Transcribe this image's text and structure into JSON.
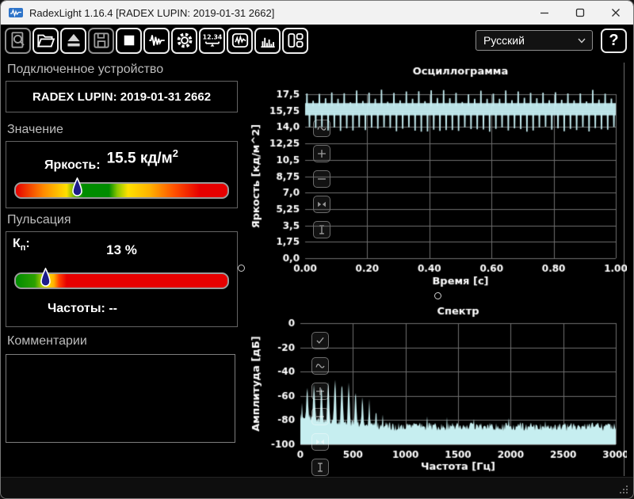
{
  "window": {
    "title": "RadexLight 1.16.4 [RADEX LUPIN: 2019-01-31 2662]"
  },
  "toolbar": {
    "buttons": [
      {
        "name": "scan-device",
        "icon": "magnifier-document-icon",
        "enabled": false
      },
      {
        "name": "open-file",
        "icon": "open-folder-icon",
        "enabled": true
      },
      {
        "name": "eject-device",
        "icon": "eject-icon",
        "enabled": true
      },
      {
        "name": "save-file",
        "icon": "floppy-save-icon",
        "enabled": false
      },
      {
        "name": "stop-measurement",
        "icon": "stop-square-icon",
        "enabled": true
      },
      {
        "name": "waveform-mode",
        "icon": "waveform-icon",
        "enabled": true
      },
      {
        "name": "settings",
        "icon": "gear-icon",
        "enabled": true
      },
      {
        "name": "numeric-display-mode",
        "icon": "digital-display-icon",
        "enabled": true,
        "glyph_text": "12.34"
      },
      {
        "name": "oscillogram-view",
        "icon": "line-chart-icon",
        "enabled": true
      },
      {
        "name": "spectrum-view",
        "icon": "bar-chart-icon",
        "enabled": true
      },
      {
        "name": "split-layout-view",
        "icon": "split-layout-icon",
        "enabled": true
      }
    ],
    "language_select": {
      "value": "Русский"
    },
    "help_button_label": "?"
  },
  "device_panel": {
    "section_label": "Подключенное устройство",
    "device_name": "RADEX LUPIN: 2019-01-31 2662"
  },
  "value_panel": {
    "section_label": "Значение",
    "label": "Яркость:",
    "value": "15.5",
    "unit": "кд/м",
    "unit_sup": "2",
    "marker_pos_pct": 29
  },
  "pulsation_panel": {
    "section_label": "Пульсация",
    "kp_label": "К",
    "kp_sub": "п",
    "kp_colon": ":",
    "kp_value": "13 %",
    "freq_label": "Частоты:",
    "freq_value": "--",
    "marker_pos_pct": 14
  },
  "comments_panel": {
    "section_label": "Комментарии",
    "text": ""
  },
  "chart_tools": {
    "oscillogram": [
      {
        "name": "wave-style",
        "icon": "wave-box-icon"
      },
      {
        "name": "zoom-in",
        "icon": "plus-icon"
      },
      {
        "name": "zoom-out",
        "icon": "minus-icon"
      },
      {
        "name": "fit-view",
        "icon": "fit-arrows-icon"
      },
      {
        "name": "cursor",
        "icon": "ibeam-icon"
      }
    ],
    "spectrum": [
      {
        "name": "autoscale",
        "icon": "check-box-icon"
      },
      {
        "name": "wave-style",
        "icon": "wave-box-icon"
      },
      {
        "name": "zoom-in",
        "icon": "plus-icon"
      },
      {
        "name": "zoom-out",
        "icon": "minus-icon"
      },
      {
        "name": "fit-view",
        "icon": "fit-arrows-icon"
      },
      {
        "name": "cursor",
        "icon": "ibeam-icon"
      }
    ]
  },
  "chart_data": [
    {
      "id": "oscillogram",
      "type": "line",
      "title": "Осциллограмма",
      "xlabel": "Время [с]",
      "ylabel": "Яркость [кд/м^2]",
      "x_ticks": [
        "0.00",
        "0.20",
        "0.40",
        "0.60",
        "0.80",
        "1.00"
      ],
      "x_range": [
        0,
        1
      ],
      "y_ticks": [
        "17,5",
        "15,75",
        "14,0",
        "12,25",
        "10,5",
        "8,75",
        "7,0",
        "5,25",
        "3,5",
        "1,75",
        "0,0"
      ],
      "y_range": [
        0,
        17.5
      ],
      "grid": true,
      "line_color": "#c5eef2",
      "signal": {
        "shape": "periodic-flicker-pulses",
        "periods_visible": 50,
        "band_low": 15.25,
        "band_high": 16.55,
        "spike_high_max": 18.0,
        "spike_high_min": 16.9,
        "spike_low": 13.5
      }
    },
    {
      "id": "spectrum",
      "type": "area",
      "title": "Спектр",
      "xlabel": "Частота [Гц]",
      "ylabel": "Амплитуда [дБ]",
      "x_ticks": [
        0,
        500,
        1000,
        1500,
        2000,
        2500,
        3000
      ],
      "x_range": [
        0,
        3000
      ],
      "y_ticks": [
        0,
        -20,
        -40,
        -60,
        -80,
        -100
      ],
      "y_range": [
        -100,
        0
      ],
      "grid": true,
      "fill_color": "#c6eef0",
      "baseline_db": -100,
      "peaks": [
        [
          15,
          -64
        ],
        [
          65,
          -46
        ],
        [
          130,
          -44
        ],
        [
          200,
          -46
        ],
        [
          265,
          -44
        ],
        [
          330,
          -42
        ],
        [
          395,
          -43
        ],
        [
          460,
          -46
        ],
        [
          525,
          -50
        ],
        [
          590,
          -55
        ],
        [
          655,
          -60
        ],
        [
          720,
          -66
        ],
        [
          785,
          -72
        ],
        [
          850,
          -75
        ],
        [
          1395,
          -75
        ]
      ],
      "noise": {
        "floor_low_freq_db": -77,
        "floor_high_freq_db": -85.5,
        "transition_hz": 800,
        "jitter_db": 7
      }
    }
  ]
}
